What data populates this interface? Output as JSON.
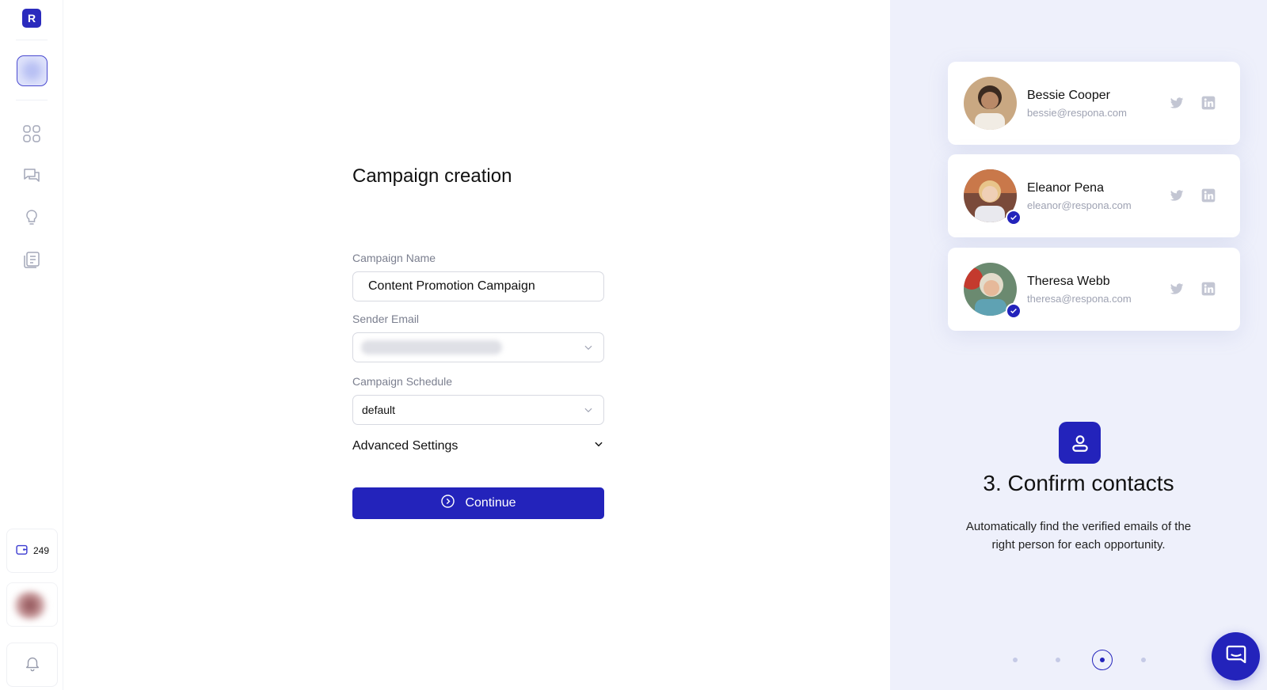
{
  "sidebar": {
    "logo_letter": "R",
    "nav_icons": [
      "grid-icon",
      "chat-icon",
      "lightbulb-icon",
      "list-icon"
    ],
    "credits": {
      "icon": "wallet-icon",
      "value": "249"
    },
    "bell_icon": "bell-icon"
  },
  "form": {
    "title": "Campaign creation",
    "campaign_name_label": "Campaign Name",
    "campaign_name_value": "Content Promotion Campaign",
    "sender_email_label": "Sender Email",
    "campaign_schedule_label": "Campaign Schedule",
    "campaign_schedule_value": "default",
    "advanced_label": "Advanced Settings",
    "continue_label": "Continue"
  },
  "contacts": [
    {
      "name": "Bessie Cooper",
      "email": "bessie@respona.com",
      "verified": false
    },
    {
      "name": "Eleanor Pena",
      "email": "eleanor@respona.com",
      "verified": true
    },
    {
      "name": "Theresa Webb",
      "email": "theresa@respona.com",
      "verified": true
    }
  ],
  "onboarding": {
    "step_title": "3. Confirm contacts",
    "step_description": "Automatically find the verified emails of the right person for each opportunity.",
    "pagination": {
      "total": 4,
      "active": 3
    }
  },
  "colors": {
    "primary": "#2323bb",
    "panel_bg": "#eef0fb"
  }
}
